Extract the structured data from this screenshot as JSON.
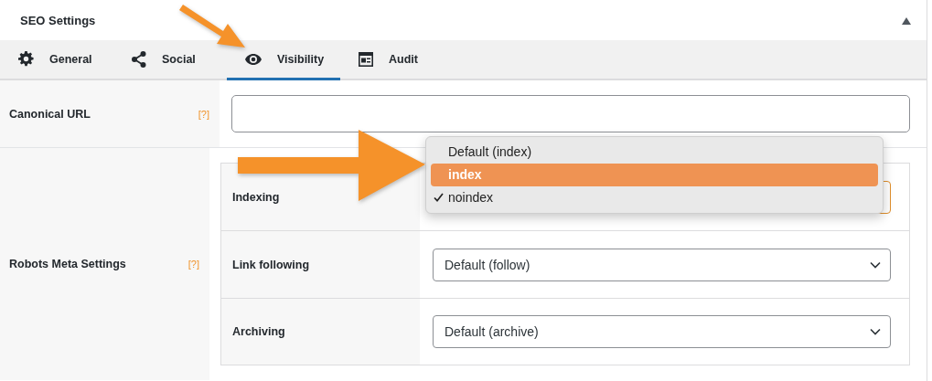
{
  "panel": {
    "title": "SEO Settings",
    "collapsed": false
  },
  "tabs": [
    {
      "label": "General",
      "kind": "gear",
      "selected": false
    },
    {
      "label": "Social",
      "kind": "share",
      "selected": false
    },
    {
      "label": "Visibility",
      "kind": "eye",
      "selected": true
    },
    {
      "label": "Audit",
      "kind": "report",
      "selected": false
    }
  ],
  "canonical": {
    "label": "Canonical URL",
    "help": "[?]"
  },
  "robots": {
    "label": "Robots Meta Settings",
    "help": "[?]",
    "rows": [
      {
        "label": "Indexing",
        "open": true,
        "options": [
          {
            "label": "Default (index)",
            "highlighted": false,
            "checked": false
          },
          {
            "label": "index",
            "highlighted": true,
            "checked": false
          },
          {
            "label": "noindex",
            "highlighted": false,
            "checked": true
          }
        ]
      },
      {
        "label": "Link following",
        "open": false,
        "value": "Default (follow)"
      },
      {
        "label": "Archiving",
        "open": false,
        "value": "Default (archive)"
      }
    ]
  }
}
